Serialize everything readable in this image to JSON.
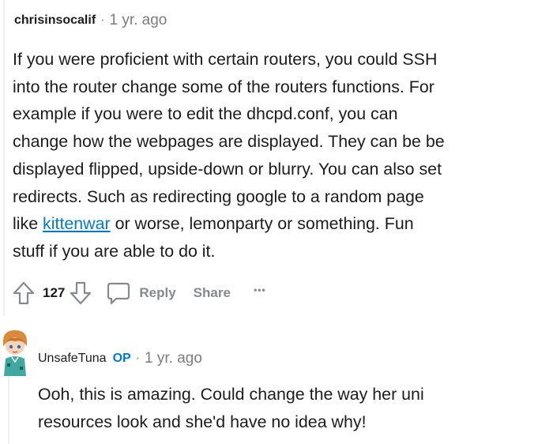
{
  "comment1": {
    "author": "chrisinsocalif",
    "separator": "·",
    "time": "1 yr. ago",
    "lines": [
      "If you were proficient with certain routers, you could SSH",
      "into the router change some of the routers functions. For",
      "example if you were to edit the dhcpd.conf, you can",
      "change how the webpages are displayed. They can be be",
      "displayed flipped, upside-down or blurry. You can also set",
      "redirects. Such as redirecting google to a random page"
    ],
    "line7_prefix": "like ",
    "link_text": "kittenwar",
    "line7_suffix": " or worse, lemonparty or something. Fun",
    "line8": "stuff if you are able to do it.",
    "score": "127",
    "reply_label": "Reply",
    "share_label": "Share",
    "more_label": "•••"
  },
  "comment2": {
    "author": "UnsafeTuna",
    "op_badge": "OP",
    "separator": "·",
    "time": "1 yr. ago",
    "lines": [
      "Ooh, this is amazing. Could change the way her uni",
      "resources look and she'd have no idea why!"
    ]
  },
  "icons": {
    "upvote": "upvote-arrow-icon",
    "downvote": "downvote-arrow-icon",
    "reply": "speech-bubble-icon",
    "avatar": "avatar-icon"
  },
  "colors": {
    "link": "#0079d3",
    "op_badge": "#0079d3",
    "meta": "#7c7c7c",
    "action": "#878a8c",
    "text": "#1c1c1c"
  }
}
